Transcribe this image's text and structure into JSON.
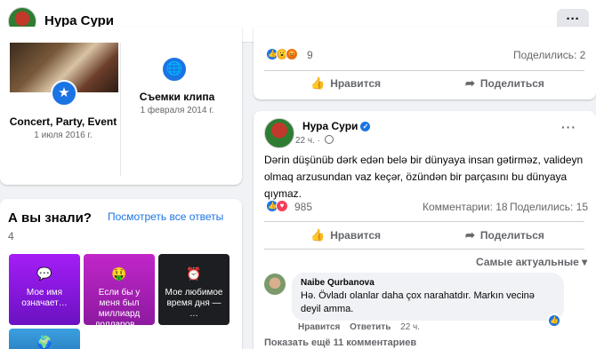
{
  "header": {
    "page_name": "Нура Сури",
    "more_label": "···"
  },
  "albums": [
    {
      "title": "Concert, Party, Event",
      "date": "1 июля 2016 г.",
      "badge": "★"
    },
    {
      "title": "Съемки клипа",
      "date": "1 февраля 2014 г.",
      "badge": "🌐"
    }
  ],
  "know": {
    "title": "А вы знали?",
    "see_all": "Посмотреть все ответы",
    "count": "4",
    "tiles": [
      {
        "emoji": "💬",
        "text": "Мое имя означает…"
      },
      {
        "emoji": "🤑",
        "text": "Если бы у меня был миллиард долларов…"
      },
      {
        "emoji": "⏰",
        "text": "Мое любимое время дня — …"
      },
      {
        "emoji": "🌍",
        "text": ""
      }
    ]
  },
  "post1": {
    "reaction_count": "9",
    "shares": "Поделились: 2",
    "like_label": "Нравится",
    "share_label": "Поделиться"
  },
  "post2": {
    "author": "Нура Сури",
    "time": "22 ч.",
    "text": "Dərin düşünüb dərk edən belə bir dünyaya insan gətirməz, valideyn olmaq arzusundan vaz keçər, özündən bir parçasını bu dünyaya qıymaz.",
    "reaction_count": "985",
    "comments": "Комментарии: 18",
    "shares": "Поделились: 15",
    "like_label": "Нравится",
    "share_label": "Поделиться",
    "sort_label": "Самые актуальные ▾",
    "comment": {
      "author": "Naibe Qurbanova",
      "text": "Hə. Övladı olanlar daha çox narahatdır. Markın vecinə deyil amma.",
      "like_action": "Нравится",
      "reply_action": "Ответить",
      "time": "22 ч."
    },
    "more_comments": "Показать ещё 11 комментариев"
  },
  "colors": {
    "accent": "#1b74e4",
    "text_secondary": "#65676b",
    "background": "#f0f2f5"
  },
  "icons": {
    "like": "thumbs-up-icon",
    "share": "share-arrow-icon"
  }
}
